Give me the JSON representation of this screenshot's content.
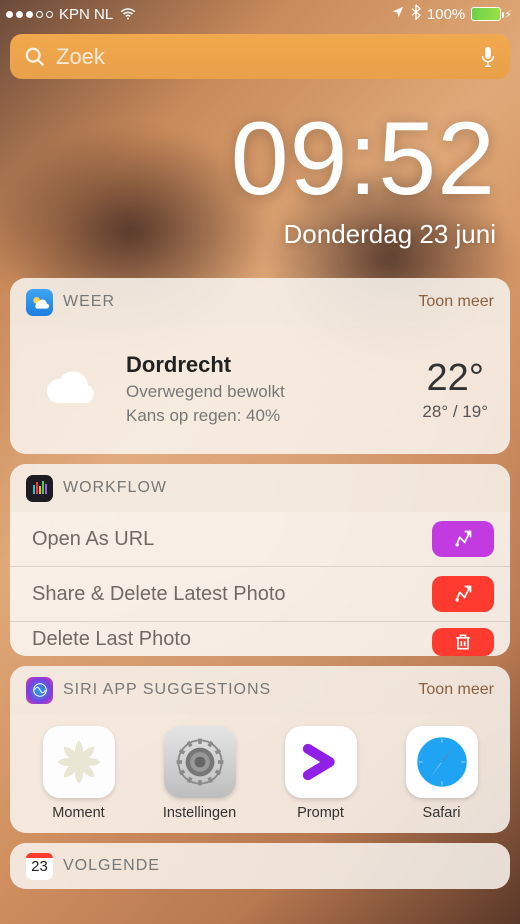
{
  "status_bar": {
    "carrier": "KPN NL",
    "battery_pct": "100%"
  },
  "search": {
    "placeholder": "Zoek"
  },
  "clock": {
    "time": "09:52",
    "date": "Donderdag 23 juni"
  },
  "weather": {
    "title": "WEER",
    "show_more": "Toon meer",
    "city": "Dordrecht",
    "condition": "Overwegend bewolkt",
    "rain_chance": "Kans op regen: 40%",
    "current": "22°",
    "hilo": "28° / 19°"
  },
  "workflow": {
    "title": "WORKFLOW",
    "rows": [
      {
        "label": "Open As URL"
      },
      {
        "label": "Share & Delete Latest Photo"
      },
      {
        "label": "Delete Last Photo"
      }
    ]
  },
  "siri": {
    "title": "SIRI APP SUGGESTIONS",
    "show_more": "Toon meer",
    "apps": [
      {
        "label": "Moment"
      },
      {
        "label": "Instellingen"
      },
      {
        "label": "Prompt"
      },
      {
        "label": "Safari"
      }
    ]
  },
  "volgende": {
    "title": "VOLGENDE",
    "day": "23"
  }
}
